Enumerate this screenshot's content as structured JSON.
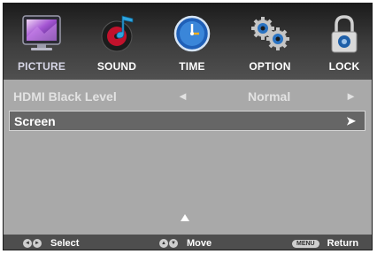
{
  "tabs": [
    {
      "label": "PICTURE",
      "icon": "monitor-icon",
      "active": true
    },
    {
      "label": "SOUND",
      "icon": "music-icon",
      "active": false
    },
    {
      "label": "TIME",
      "icon": "clock-icon",
      "active": false
    },
    {
      "label": "OPTION",
      "icon": "gears-icon",
      "active": false
    },
    {
      "label": "LOCK",
      "icon": "padlock-icon",
      "active": false
    }
  ],
  "menu": {
    "hdmi": {
      "label": "HDMI Black Level",
      "left_arrow": "◄",
      "value": "Normal",
      "right_arrow": "►"
    },
    "screen": {
      "label": "Screen",
      "arrow": "➤"
    }
  },
  "footer": {
    "select": {
      "label": "Select",
      "keys": [
        "◄",
        "►"
      ]
    },
    "move": {
      "label": "Move",
      "keys": [
        "▲",
        "▼"
      ]
    },
    "return": {
      "label": "Return",
      "key": "MENU"
    }
  },
  "colors": {
    "topbar": "#2e2e2e",
    "panel": "#a9a9a9",
    "selected_row": "#666666",
    "footer": "#4e4e4e"
  }
}
